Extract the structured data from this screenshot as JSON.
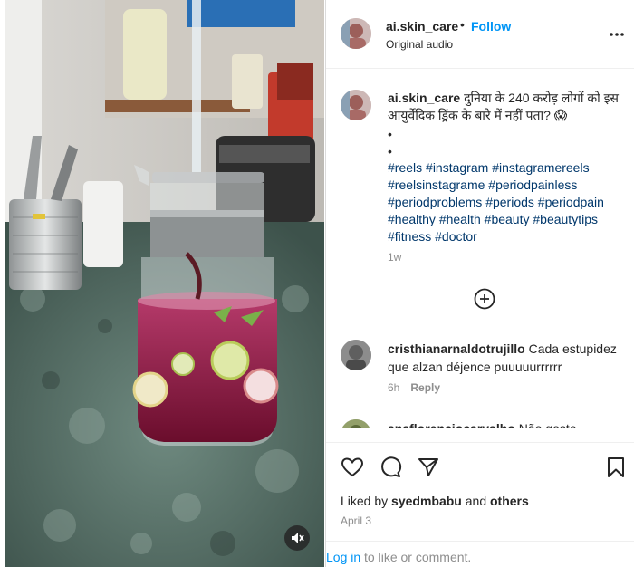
{
  "header": {
    "username": "ai.skin_care",
    "separator": "•",
    "follow_label": "Follow",
    "audio_label": "Original audio"
  },
  "caption": {
    "username": "ai.skin_care",
    "text": "दुनिया के 240 करोड़ लोगों को इस आयुर्वेदिक ड्रिंक के बारे में नहीं पता? 😱",
    "dot1": "•",
    "dot2": "•",
    "hashtags": [
      "#reels",
      "#instagram",
      "#instagramereels",
      "#reelsinstagrame",
      "#periodpainless",
      "#periodproblems",
      "#periods",
      "#periodpain",
      "#healthy",
      "#health",
      "#beauty",
      "#beautytips",
      "#fitness",
      "#doctor"
    ],
    "time": "1w"
  },
  "comments": [
    {
      "username": "cristhianarnaldotrujillo",
      "text": "Cada estupidez que alzan déjence puuuuurrrrrr",
      "time": "6h",
      "reply_label": "Reply"
    },
    {
      "username": "anaflorenciocarvalho",
      "text": "Não gosto"
    }
  ],
  "actions": {
    "like_icon": "heart-icon",
    "comment_icon": "comment-icon",
    "share_icon": "send-icon",
    "save_icon": "bookmark-icon"
  },
  "likes": {
    "prefix": "Liked by",
    "user": "syedmbabu",
    "middle": "and",
    "others": "others"
  },
  "date": "April 3",
  "login": {
    "link": "Log in",
    "rest": " to like or comment."
  },
  "colors": {
    "accent": "#0095f6",
    "hashtag": "#00376b",
    "secondary_text": "#8e8e8e"
  }
}
